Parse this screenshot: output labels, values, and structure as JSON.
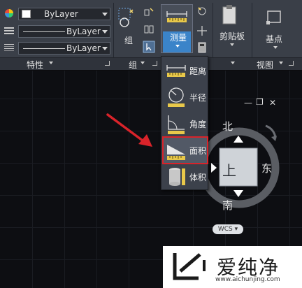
{
  "properties": {
    "color_value": "ByLayer",
    "linetype_value": "ByLayer",
    "lineweight_value": "ByLayer"
  },
  "ribbon": {
    "groups_label": "组",
    "measure_label": "测量",
    "clipboard_label": "剪贴板",
    "basepoint_label": "基点"
  },
  "panel_footer": {
    "properties": "特性",
    "groups": "组",
    "view": "视图"
  },
  "measure_menu": [
    {
      "label": "距离",
      "icon": "distance-icon"
    },
    {
      "label": "半径",
      "icon": "radius-icon"
    },
    {
      "label": "角度",
      "icon": "angle-icon"
    },
    {
      "label": "面积",
      "icon": "area-icon"
    },
    {
      "label": "体积",
      "icon": "volume-icon"
    }
  ],
  "viewcube": {
    "north": "北",
    "south": "南",
    "east": "东",
    "face": "上",
    "wcs": "WCS"
  },
  "watermark": {
    "text": "爱纯净",
    "url": "www.aichunjing.com"
  },
  "colors": {
    "ribbon": "#3a3f48",
    "canvas": "#0d0e12",
    "highlight_blue": "#3b84c9",
    "annotation_red": "#d9232a"
  }
}
